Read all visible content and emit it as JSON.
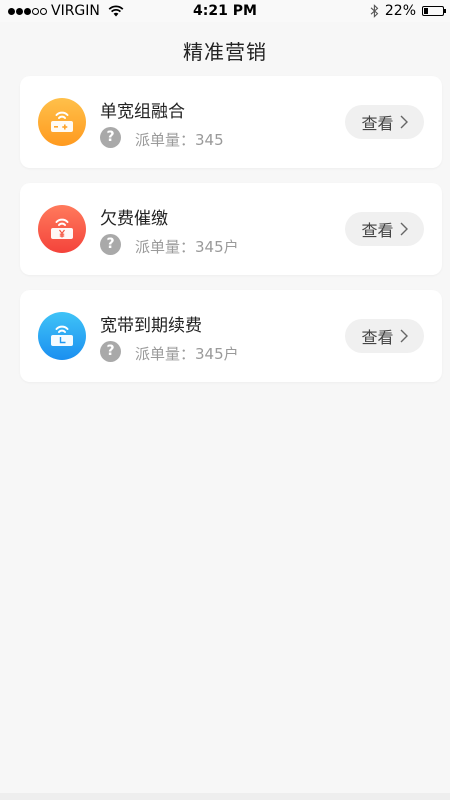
{
  "status_bar": {
    "carrier": "VIRGIN",
    "time": "4:21 PM",
    "battery_percent": "22%",
    "battery_level": 0.22,
    "signal_bars": 3,
    "signal_total": 5,
    "icons": [
      "wifi-icon",
      "bluetooth-icon",
      "battery-icon"
    ]
  },
  "header": {
    "title": "精准营销"
  },
  "cards": [
    {
      "title": "单宽组融合",
      "count_text": "派单量：345",
      "button_label": "查看",
      "icon": "router-plus-icon",
      "color_top": "#ffc04a",
      "color_bottom": "#ff9a1f"
    },
    {
      "title": "欠费催缴",
      "count_text": "派单量：345户",
      "button_label": "查看",
      "icon": "router-yen-icon",
      "color_top": "#ff7a5c",
      "color_bottom": "#f4433b"
    },
    {
      "title": "宽带到期续费",
      "count_text": "派单量：345户",
      "button_label": "查看",
      "icon": "router-clock-icon",
      "color_top": "#3fc3f7",
      "color_bottom": "#1b8ff0"
    }
  ],
  "help_symbol": "?"
}
